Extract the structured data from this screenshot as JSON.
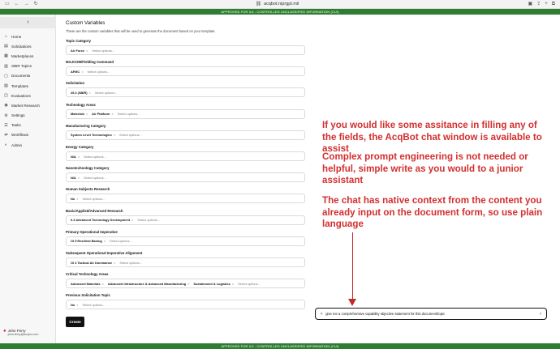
{
  "browser": {
    "url": "acqbot.niprgpt.mil"
  },
  "banner": {
    "top": "APPROVED FOR IL5 - CONTROLLED UNCLASSIFIED INFORMATION (CUI)",
    "bottom": "APPROVED FOR IL5 - CONTROLLED UNCLASSIFIED INFORMATION (CUI)"
  },
  "sidebar": {
    "collapse_glyph": "‹",
    "items": [
      {
        "label": "Home",
        "icon": "⌂"
      },
      {
        "label": "Solicitations",
        "icon": "▤"
      },
      {
        "label": "Marketplaces",
        "icon": "▦"
      },
      {
        "label": "SBIR Topics",
        "icon": "▥"
      },
      {
        "label": "Documents",
        "icon": "▢"
      },
      {
        "label": "Templates",
        "icon": "▧"
      },
      {
        "label": "Evaluations",
        "icon": "◫"
      },
      {
        "label": "Market Research",
        "icon": "◉"
      },
      {
        "label": "Settings",
        "icon": "⚙"
      },
      {
        "label": "Tasks",
        "icon": "☰"
      },
      {
        "label": "Workflows",
        "icon": "⇄"
      },
      {
        "label": "Admin",
        "icon": "◐"
      }
    ],
    "user": {
      "name": "John Ferry",
      "email": "john.ferry@acqov.com",
      "icon": "●"
    }
  },
  "form": {
    "title": "Custom Variables",
    "description": "These are the custom variables that will be used to generate the document based on your template.",
    "placeholder": "Select options...",
    "remove_glyph": "×",
    "fields": [
      {
        "label": "Topic Category",
        "chips": [
          "Air Force"
        ]
      },
      {
        "label": "MAJCOM/Fielding Command",
        "chips": [
          "AFMC"
        ]
      },
      {
        "label": "Solicitation",
        "chips": [
          "25.3 (SBIR)"
        ]
      },
      {
        "label": "Technology Areas",
        "chips": [
          "Materials",
          "Air Platform"
        ]
      },
      {
        "label": "Manufacturing Category",
        "chips": [
          "System Level Technologies"
        ]
      },
      {
        "label": "Energy Category",
        "chips": [
          "N/A"
        ]
      },
      {
        "label": "Nanotechnology Category",
        "chips": [
          "N/A"
        ]
      },
      {
        "label": "Human Subjects Research",
        "chips": [
          "No"
        ]
      },
      {
        "label": "Basic/Applied/Advanced Research",
        "chips": [
          "6.3 Advanced Technology Development"
        ]
      },
      {
        "label": "Primary Operational Imperative",
        "chips": [
          "OI 5 Resilient Basing"
        ]
      },
      {
        "label": "Subsequent Operational Imperative Alignment",
        "chips": [
          "OI 4 Tactical Air Dominance"
        ]
      },
      {
        "label": "Critical Technology Areas",
        "chips": [
          "Advanced Materials",
          "Advanced Infrastructure & Advanced Manufacturing",
          "Sustainment & Logistics"
        ]
      },
      {
        "label": "Previous Solicitation Topic",
        "chips": [
          "No"
        ]
      }
    ],
    "create_label": "Create"
  },
  "annotations": [
    "If you would like some assitance in filling any of the fields, the AcqBot chat window is available to assist",
    "Complex prompt engineering is not needed or helpful, simple write as you would to a junior assistant",
    "The chat has native context from the content you already input on the document form, so use plain language"
  ],
  "chat": {
    "text": "give me a comprehensive capability objective statement for this document/topic",
    "icon": "sparkle-icon",
    "send_icon": "chevron-right-icon"
  },
  "colors": {
    "banner": "#2e7d32",
    "annotation": "#d32f2f",
    "button": "#111111"
  }
}
